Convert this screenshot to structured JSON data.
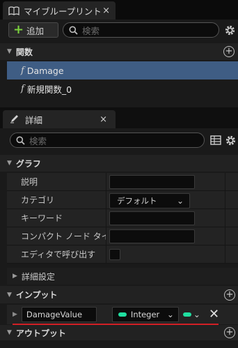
{
  "my_blueprint_tab": {
    "title": "マイブループリント",
    "close": "×"
  },
  "toolbar": {
    "add_label": "追加",
    "search_placeholder": "検索"
  },
  "functions_category": {
    "label": "関数"
  },
  "functions": [
    {
      "name": "Damage",
      "selected": true
    },
    {
      "name": "新規関数_0",
      "selected": false
    }
  ],
  "details_tab": {
    "title": "詳細",
    "close": "×"
  },
  "details_search_placeholder": "検索",
  "graph_category": {
    "label": "グラフ"
  },
  "graph_props": {
    "description": "説明",
    "category": "カテゴリ",
    "category_value": "デフォルト",
    "keywords": "キーワード",
    "compact_node_title": "コンパクト ノード タイト",
    "call_in_editor": "エディタで呼び出す"
  },
  "advanced_settings": {
    "label": "詳細設定"
  },
  "inputs_category": {
    "label": "インプット"
  },
  "input_param": {
    "name": "DamageValue",
    "type": "Integer",
    "type_color": "#20dfa0"
  },
  "outputs_category": {
    "label": "アウトプット"
  },
  "colors": {
    "selection": "#3f5d84",
    "highlight_underline": "#d21f25",
    "add_green": "#7bd23d"
  }
}
